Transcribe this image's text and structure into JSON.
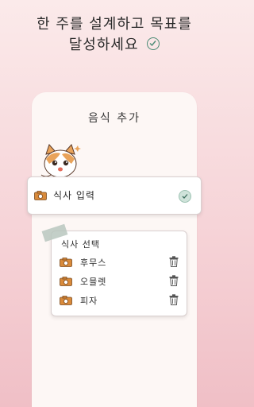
{
  "headline": {
    "line1": "한 주를 설계하고 목표를",
    "line2": "달성하세요"
  },
  "screen": {
    "title": "음식 추가"
  },
  "input_card": {
    "label": "식사 입력"
  },
  "list_card": {
    "title": "식사 선택",
    "items": [
      {
        "label": "후무스"
      },
      {
        "label": "오믈렛"
      },
      {
        "label": "피자"
      }
    ]
  },
  "colors": {
    "accent": "#4a8a74",
    "camera": "#d98a3a",
    "background": "#f6d4d8"
  },
  "icons": [
    "check-circle-icon",
    "cat-mascot",
    "camera-icon",
    "trash-icon"
  ]
}
